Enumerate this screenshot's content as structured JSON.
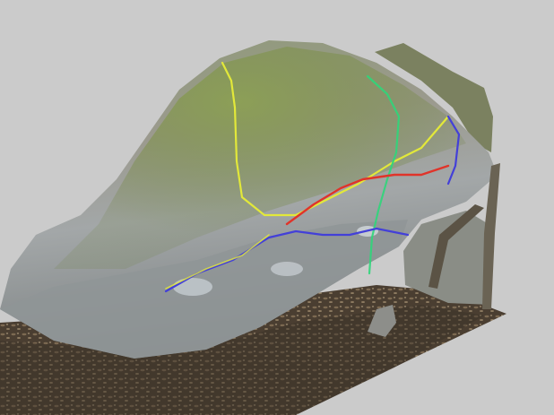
{
  "scene": {
    "subject": "boulder-3d-scan",
    "background_color": "#cbcbcb",
    "colors": {
      "rock_light": "#9da2a3",
      "rock_shadow": "#6d7070",
      "moss": "#7f9441",
      "moss_dark": "#5f7232",
      "ground": "#4e4235",
      "leaves": "#7a6650",
      "wood": "#6a6354"
    },
    "routes": [
      {
        "id": "yellow-route",
        "color": "#e2e83a"
      },
      {
        "id": "green-route",
        "color": "#2fd67a"
      },
      {
        "id": "red-route",
        "color": "#e0342a"
      },
      {
        "id": "blue-route",
        "color": "#4340d8"
      }
    ]
  }
}
